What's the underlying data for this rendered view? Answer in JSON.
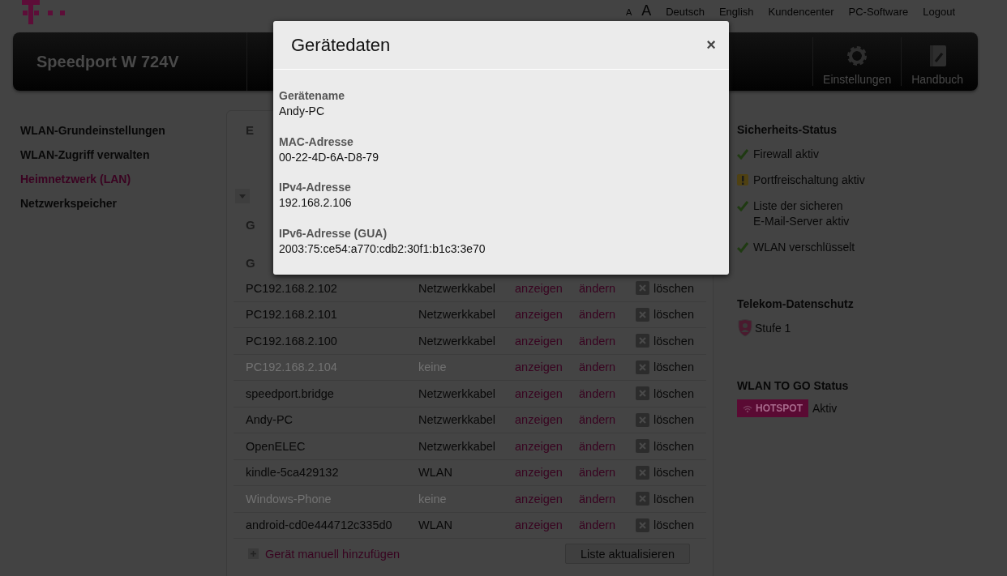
{
  "top_links": [
    {
      "label": "A",
      "kind": "small"
    },
    {
      "label": "A",
      "kind": "large"
    },
    {
      "label": "Deutsch",
      "kind": "link"
    },
    {
      "label": "English",
      "kind": "link"
    },
    {
      "label": "Kundencenter",
      "kind": "link"
    },
    {
      "label": "PC-Software",
      "kind": "link"
    },
    {
      "label": "Logout",
      "kind": "link"
    }
  ],
  "header": {
    "title": "Speedport W 724V",
    "buttons": [
      {
        "label": "Einstellungen",
        "kind": "gear"
      },
      {
        "label": "Handbuch",
        "kind": "book"
      }
    ]
  },
  "sidebar": {
    "items": [
      {
        "label": "WLAN-Grundeinstellungen",
        "selected": false
      },
      {
        "label": "WLAN-Zugriff verwalten",
        "selected": false
      },
      {
        "label": "Heimnetzwerk (LAN)",
        "selected": true
      },
      {
        "label": "Netzwerkspeicher",
        "selected": false
      }
    ]
  },
  "content": {
    "heading": "E",
    "subheadings": [
      "G",
      "G"
    ],
    "devices": [
      {
        "name": "PC192.168.2.102",
        "connection": "Netzwerkkabel",
        "show": "anzeigen",
        "edit": "ändern",
        "delete": "löschen",
        "disabled": false
      },
      {
        "name": "PC192.168.2.101",
        "connection": "Netzwerkkabel",
        "show": "anzeigen",
        "edit": "ändern",
        "delete": "löschen",
        "disabled": false
      },
      {
        "name": "PC192.168.2.100",
        "connection": "Netzwerkkabel",
        "show": "anzeigen",
        "edit": "ändern",
        "delete": "löschen",
        "disabled": false
      },
      {
        "name": "PC192.168.2.104",
        "connection": "keine",
        "show": "anzeigen",
        "edit": "ändern",
        "delete": "löschen",
        "disabled": true
      },
      {
        "name": "speedport.bridge",
        "connection": "Netzwerkkabel",
        "show": "anzeigen",
        "edit": "ändern",
        "delete": "löschen",
        "disabled": false
      },
      {
        "name": "Andy-PC",
        "connection": "Netzwerkkabel",
        "show": "anzeigen",
        "edit": "ändern",
        "delete": "löschen",
        "disabled": false
      },
      {
        "name": "OpenELEC",
        "connection": "Netzwerkkabel",
        "show": "anzeigen",
        "edit": "ändern",
        "delete": "löschen",
        "disabled": false
      },
      {
        "name": "kindle-5ca429132",
        "connection": "WLAN",
        "show": "anzeigen",
        "edit": "ändern",
        "delete": "löschen",
        "disabled": false
      },
      {
        "name": "Windows-Phone",
        "connection": "keine",
        "show": "anzeigen",
        "edit": "ändern",
        "delete": "löschen",
        "disabled": true
      },
      {
        "name": "android-cd0e444712c335d0",
        "connection": "WLAN",
        "show": "anzeigen",
        "edit": "ändern",
        "delete": "löschen",
        "disabled": false
      }
    ],
    "add_link": "Gerät manuell hinzufügen",
    "refresh_button": "Liste aktualisieren"
  },
  "security_status": {
    "title": "Sicherheits-Status",
    "items": [
      {
        "label": "Firewall aktiv",
        "kind": "ok"
      },
      {
        "label": "Portfreischaltung aktiv",
        "kind": "warning"
      },
      {
        "label": "Liste der sicheren\nE-Mail-Server aktiv",
        "kind": "ok"
      },
      {
        "label": "WLAN verschlüsselt",
        "kind": "ok"
      }
    ]
  },
  "privacy": {
    "title": "Telekom-Datenschutz",
    "level_label": "Stufe 1"
  },
  "wlan_to_go": {
    "title": "WLAN TO GO Status",
    "badge": "HOTSPOT",
    "status": "Aktiv"
  },
  "dialog": {
    "title": "Gerätedaten",
    "close": "×",
    "fields": [
      {
        "label": "Gerätename",
        "value": "Andy-PC"
      },
      {
        "label": "MAC-Adresse",
        "value": "00-22-4D-6A-D8-79"
      },
      {
        "label": "IPv4-Adresse",
        "value": "192.168.2.106"
      },
      {
        "label": "IPv6-Adresse (GUA)",
        "value": "2003:75:ce54:a770:cdb2:30f1:b1c3:3e70"
      }
    ]
  }
}
